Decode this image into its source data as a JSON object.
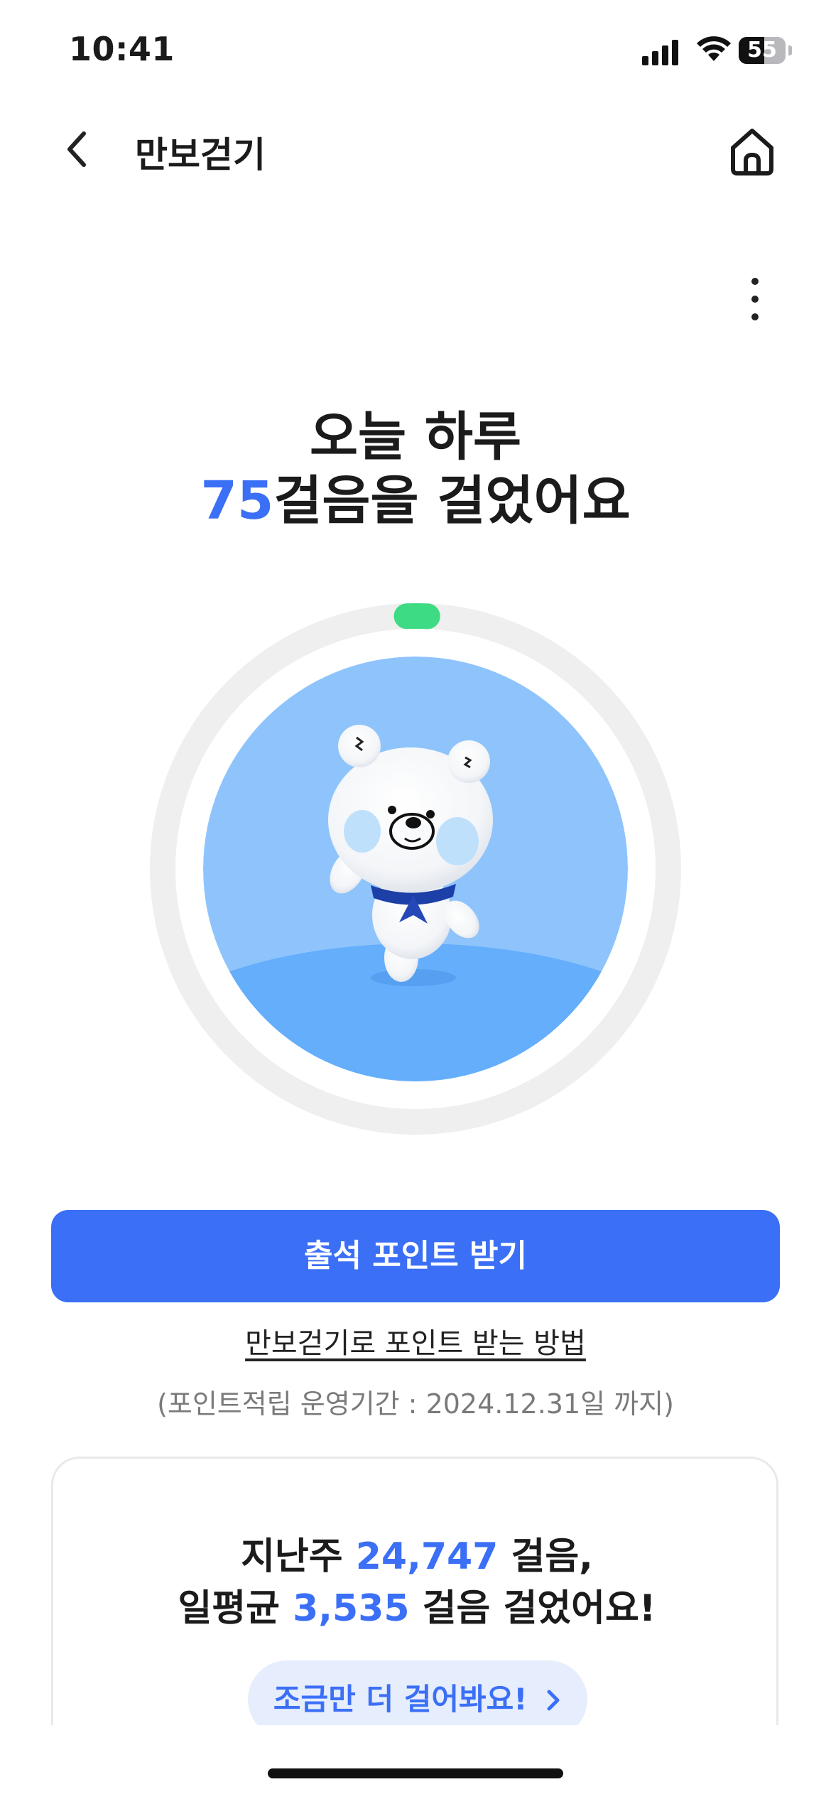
{
  "status_bar": {
    "time": "10:41",
    "battery_level": "55",
    "battery_fraction": 0.55
  },
  "header": {
    "title": "만보걷기",
    "back_icon": "chevron-left-icon",
    "home_icon": "home-icon",
    "more_icon": "more-vertical-icon"
  },
  "headline": {
    "line1": "오늘 하루",
    "steps": "75",
    "line2_suffix": "걸음을 걸었어요"
  },
  "progress": {
    "fraction": 0.0075,
    "colors": {
      "track": "#efefef",
      "indicator": "#3ddc84",
      "circle_top": "#8ec4fb",
      "circle_ground": "#64aefc"
    }
  },
  "actions": {
    "attendance_button": "출석 포인트 받기",
    "how_to_link": "만보걷기로 포인트 받는 방법",
    "period_note": "(포인트적립 운영기간 : 2024.12.31일 까지)"
  },
  "weekly": {
    "line1_prefix": "지난주 ",
    "line1_steps": "24,747",
    "line1_suffix": " 걸음,",
    "line2_prefix": "일평균 ",
    "line2_steps": "3,535",
    "line2_suffix": " 걸음 걸었어요!",
    "encourage_button": "조금만 더 걸어봐요!",
    "encourage_icon": "chevron-right-icon"
  },
  "colors": {
    "accent": "#3b6ff6",
    "text": "#1b1b1b"
  }
}
